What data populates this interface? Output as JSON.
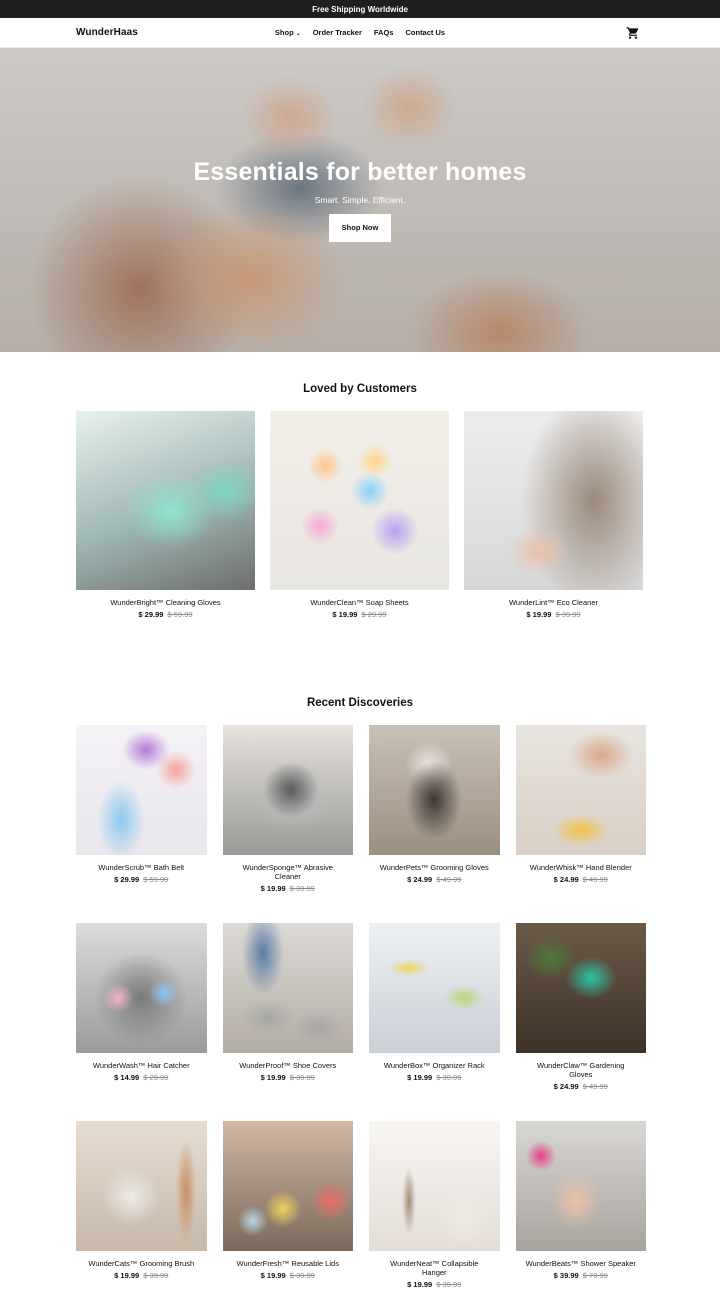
{
  "announcement": "Free Shipping Worldwide",
  "header": {
    "logo": "WunderHaas",
    "nav": [
      "Shop",
      "Order Tracker",
      "FAQs",
      "Contact Us"
    ]
  },
  "hero": {
    "title": "Essentials for better homes",
    "subtitle": "Smart. Simple. Efficient.",
    "cta": "Shop Now"
  },
  "loved": {
    "title": "Loved by Customers",
    "products": [
      {
        "name": "WunderBright™ Cleaning Gloves",
        "price": "$ 29.99",
        "was": "$ 59.99"
      },
      {
        "name": "WunderClean™ Soap Sheets",
        "price": "$ 19.99",
        "was": "$ 29.99"
      },
      {
        "name": "WunderLint™ Eco Cleaner",
        "price": "$ 19.99",
        "was": "$ 39.99"
      }
    ]
  },
  "recent": {
    "title": "Recent Discoveries",
    "products": [
      {
        "name": "WunderScrub™ Bath Belt",
        "price": "$ 29.99",
        "was": "$ 59.99"
      },
      {
        "name": "WunderSponge™ Abrasive Cleaner",
        "price": "$ 19.99",
        "was": "$ 39.99"
      },
      {
        "name": "WunderPets™ Grooming Gloves",
        "price": "$ 24.99",
        "was": "$ 49.99"
      },
      {
        "name": "WunderWhisk™ Hand Blender",
        "price": "$ 24.99",
        "was": "$ 49.99"
      },
      {
        "name": "WunderWash™ Hair Catcher",
        "price": "$ 14.99",
        "was": "$ 29.99"
      },
      {
        "name": "WunderProof™ Shoe Covers",
        "price": "$ 19.99",
        "was": "$ 39.99"
      },
      {
        "name": "WunderBox™ Organizer Rack",
        "price": "$ 19.99",
        "was": "$ 39.99"
      },
      {
        "name": "WunderClaw™ Gardening Gloves",
        "price": "$ 24.99",
        "was": "$ 49.99"
      },
      {
        "name": "WunderCats™ Grooming Brush",
        "price": "$ 19.99",
        "was": "$ 39.99"
      },
      {
        "name": "WunderFresh™ Reusable Lids",
        "price": "$ 19.99",
        "was": "$ 39.99"
      },
      {
        "name": "WunderNeat™ Collapsible Hanger",
        "price": "$ 19.99",
        "was": "$ 39.99"
      },
      {
        "name": "WunderBeats™ Shower Speaker",
        "price": "$ 39.99",
        "was": "$ 79.99"
      }
    ]
  },
  "colors": {
    "announcement_bg": "#1f1f1f",
    "text": "#111111",
    "strike_price": "#8b8b8b"
  },
  "icons": {
    "cart": "cart-icon",
    "nav_dropdown": "chevron-down-icon"
  }
}
